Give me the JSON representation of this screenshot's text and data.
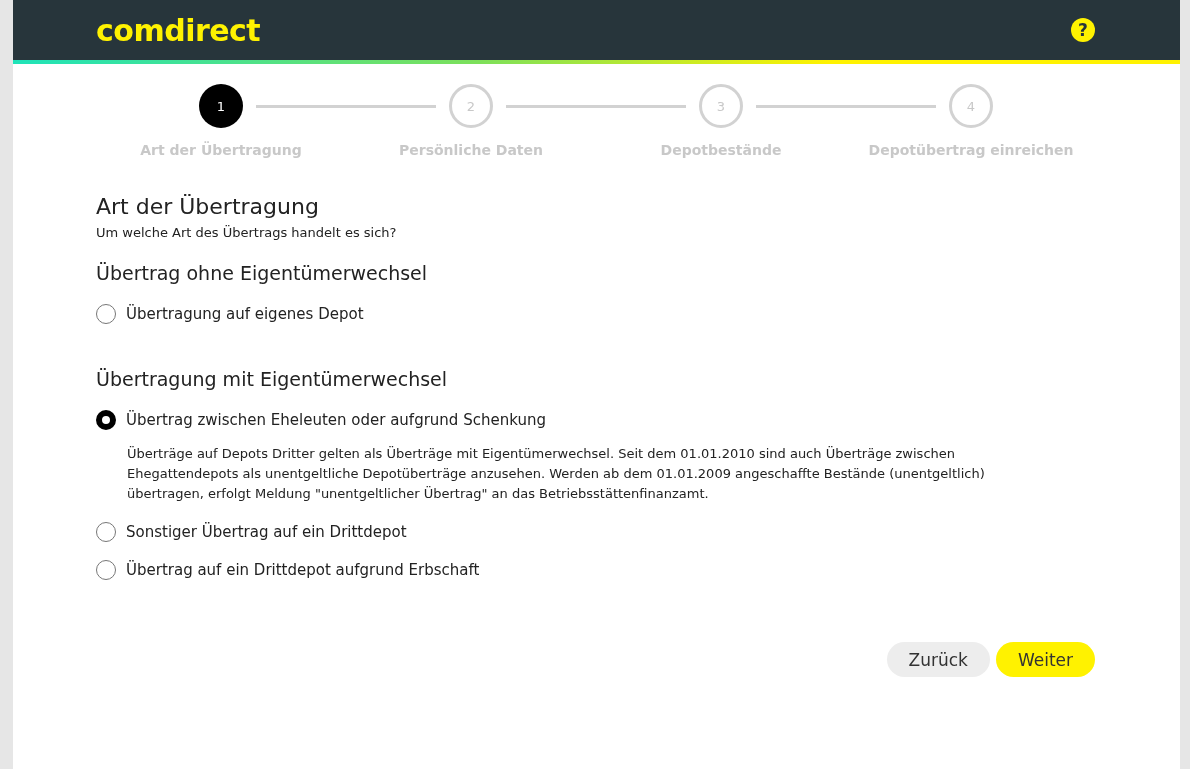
{
  "header": {
    "logo": "comdirect",
    "help": "?"
  },
  "steps": [
    {
      "number": "1",
      "label": "Art der Übertragung",
      "selected": true
    },
    {
      "number": "2",
      "label": "Persönliche Daten",
      "selected": false
    },
    {
      "number": "3",
      "label": "Depotbestände",
      "selected": false
    },
    {
      "number": "4",
      "label": "Depotübertrag einreichen",
      "selected": false
    }
  ],
  "title": "Art der Übertragung",
  "subtitle": "Um welche Art des Übertrags handelt es sich?",
  "groups": [
    {
      "title": "Übertrag ohne Eigentümerwechsel",
      "options": [
        {
          "label": "Übertragung auf eigenes Depot",
          "selected": false
        }
      ]
    },
    {
      "title": "Übertragung mit Eigentümerwechsel",
      "options": [
        {
          "label": "Übertrag zwischen Eheleuten oder aufgrund Schenkung",
          "selected": true,
          "description": "Überträge auf Depots Dritter gelten als Überträge mit Eigentümerwechsel. Seit dem 01.01.2010 sind auch Überträge zwischen Ehegattendepots als unentgeltliche Depotüberträge anzusehen. Werden ab dem 01.01.2009 angeschaffte Bestände (unentgeltlich) übertragen, erfolgt Meldung \"unentgeltlicher Übertrag\" an das Betriebsstättenfinanzamt."
        },
        {
          "label": "Sonstiger Übertrag auf ein Drittdepot",
          "selected": false
        },
        {
          "label": "Übertrag auf ein Drittdepot aufgrund Erbschaft",
          "selected": false
        }
      ]
    }
  ],
  "buttons": [
    {
      "label": "Zurück",
      "kind": "secondary"
    },
    {
      "label": "Weiter",
      "kind": "primary"
    }
  ]
}
